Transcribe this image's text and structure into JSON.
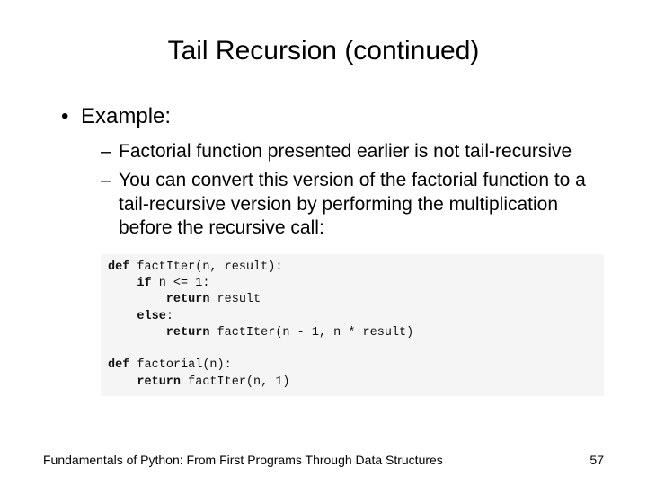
{
  "title": "Tail Recursion (continued)",
  "bullet1": "Example:",
  "sub1": "Factorial function presented earlier is not tail-recursive",
  "sub2": "You can convert this version of the factorial function to a tail-recursive version by performing the multiplication before the recursive call:",
  "code": {
    "l1a": "def",
    "l1b": " factIter(n, result):",
    "l2a": "    if",
    "l2b": " n <= 1:",
    "l3a": "        return",
    "l3b": " result",
    "l4a": "    else",
    "l4b": ":",
    "l5a": "        return",
    "l5b": " factIter(n - 1, n * result)",
    "l6": "",
    "l7a": "def",
    "l7b": " factorial(n):",
    "l8a": "    return",
    "l8b": " factIter(n, 1)"
  },
  "footer_text": "Fundamentals of Python: From First Programs Through Data Structures",
  "page_number": "57"
}
